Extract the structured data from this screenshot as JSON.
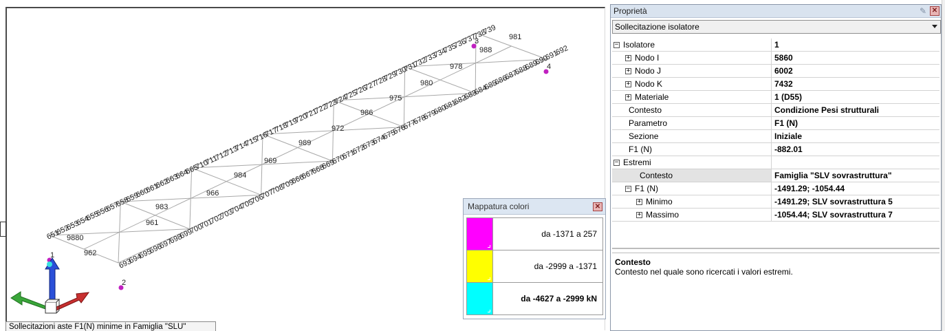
{
  "viewport": {
    "status_text": "Sollecitazioni aste F1(N) minime in Famiglia \"SLU\"",
    "node_labels_top": [
      "651",
      "652",
      "653",
      "654",
      "655",
      "656",
      "657",
      "658",
      "659",
      "660",
      "661",
      "662",
      "663",
      "664",
      "665",
      "710",
      "711",
      "712",
      "713",
      "714",
      "715",
      "716",
      "717",
      "718",
      "719",
      "720",
      "721",
      "722",
      "723",
      "724",
      "725",
      "726",
      "727",
      "728",
      "729",
      "730",
      "731",
      "732",
      "733",
      "734",
      "735",
      "736",
      "737",
      "738",
      "739"
    ],
    "node_labels_bottom": [
      "693",
      "694",
      "695",
      "696",
      "697",
      "698",
      "699",
      "700",
      "701",
      "702",
      "703",
      "704",
      "705",
      "706",
      "707",
      "708",
      "709",
      "666",
      "667",
      "668",
      "669",
      "670",
      "671",
      "672",
      "673",
      "674",
      "675",
      "676",
      "677",
      "678",
      "679",
      "680",
      "681",
      "682",
      "683",
      "684",
      "685",
      "686",
      "687",
      "688",
      "689",
      "690",
      "691",
      "692"
    ],
    "element_labels": [
      "962",
      "9880",
      "961",
      "983",
      "966",
      "984",
      "969",
      "989",
      "972",
      "986",
      "975",
      "980",
      "978",
      "988",
      "981"
    ],
    "isolator_labels": [
      "1",
      "2",
      "3",
      "4"
    ]
  },
  "colormap": {
    "title": "Mappatura colori",
    "close_icon": "close-icon",
    "rows": [
      {
        "color": "#ff00ff",
        "label": "da -1371 a 257",
        "bold": false
      },
      {
        "color": "#ffff00",
        "label": "da -2999 a -1371",
        "bold": false
      },
      {
        "color": "#00ffff",
        "label": "da -4627 a -2999 kN",
        "bold": true
      }
    ]
  },
  "props": {
    "title": "Proprietà",
    "pin_icon": "pin-icon",
    "close_icon": "close-icon",
    "selected_object": "Sollecitazione isolatore",
    "rows": [
      {
        "name": "Isolatore",
        "value": "1",
        "expander": "⊟",
        "level": 0
      },
      {
        "name": "Nodo I",
        "value": "5860",
        "expander": "⊞",
        "level": 1
      },
      {
        "name": "Nodo J",
        "value": "6002",
        "expander": "⊞",
        "level": 1
      },
      {
        "name": "Nodo K",
        "value": "7432",
        "expander": "⊞",
        "level": 1
      },
      {
        "name": "Materiale",
        "value": "1 (D55)",
        "expander": "⊞",
        "level": 1
      },
      {
        "name": "Contesto",
        "value": "Condizione Pesi strutturali",
        "expander": "",
        "level": 1
      },
      {
        "name": "Parametro",
        "value": "F1 (N)",
        "expander": "",
        "level": 1
      },
      {
        "name": "Sezione",
        "value": "Iniziale",
        "expander": "",
        "level": 1
      },
      {
        "name": "F1 (N)",
        "value": "-882.01",
        "expander": "",
        "level": 1
      },
      {
        "name": "Estremi",
        "value": "",
        "expander": "⊟",
        "level": 0
      },
      {
        "name": "Contesto",
        "value": "Famiglia \"SLV sovrastruttura\"",
        "expander": "",
        "level": 2,
        "selected": true
      },
      {
        "name": "F1 (N)",
        "value": "-1491.29; -1054.44",
        "expander": "⊟",
        "level": 1
      },
      {
        "name": "Minimo",
        "value": "-1491.29; SLV sovrastruttura 5",
        "expander": "⊞",
        "level": 2
      },
      {
        "name": "Massimo",
        "value": "-1054.44; SLV sovrastruttura 7",
        "expander": "⊞",
        "level": 2
      }
    ],
    "description_title": "Contesto",
    "description_text": "Contesto nel quale sono ricercati i valori estremi."
  }
}
